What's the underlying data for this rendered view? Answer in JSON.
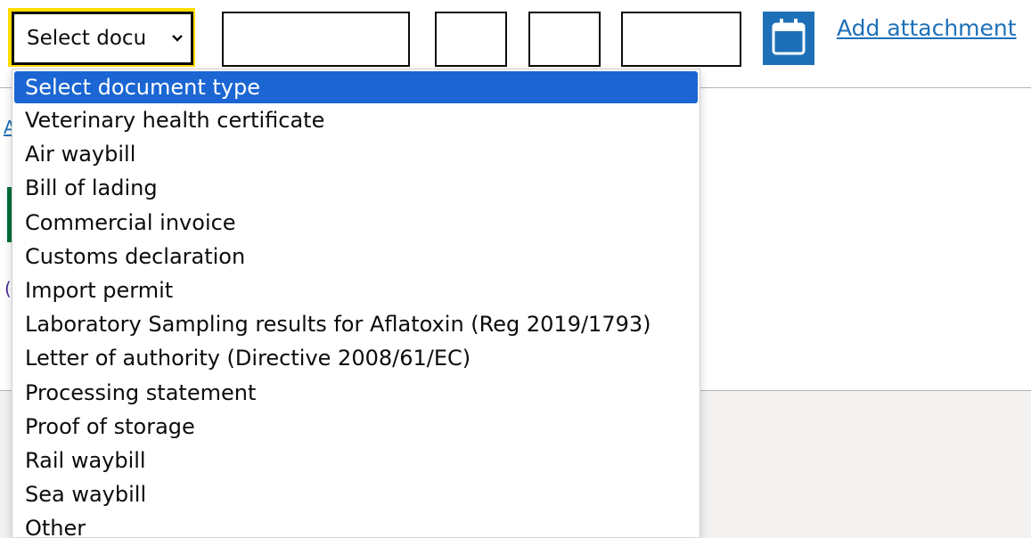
{
  "form_row": {
    "select_value": "Select docu",
    "add_attachment_label": "Add attachment"
  },
  "dropdown": {
    "options": [
      "Select document type",
      "Veterinary health certificate",
      "Air waybill",
      "Bill of lading",
      "Commercial invoice",
      "Customs declaration",
      "Import permit",
      "Laboratory Sampling results for Aflatoxin (Reg 2019/1793)",
      "Letter of authority (Directive 2008/61/EC)",
      "Processing statement",
      "Proof of storage",
      "Rail waybill",
      "Sea waybill",
      "Other"
    ],
    "selected_index": 0
  },
  "colors": {
    "focus": "#ffdd00",
    "link": "#1d70b8",
    "highlight": "#1b66d3"
  }
}
